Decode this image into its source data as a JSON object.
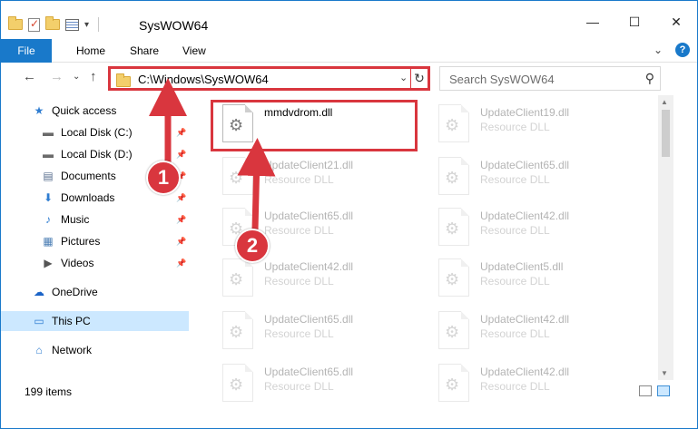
{
  "window": {
    "title": "SysWOW64",
    "controls": {
      "minimize": "—",
      "maximize": "☐",
      "close": "✕"
    }
  },
  "ribbon": {
    "tabs": [
      "File",
      "Home",
      "Share",
      "View"
    ],
    "expand": "⌄",
    "help": "?"
  },
  "nav": {
    "back": "←",
    "forward": "→",
    "recent": "⌄",
    "up": "↑",
    "address": "C:\\Windows\\SysWOW64",
    "address_dropdown": "⌄",
    "refresh": "↻",
    "search_placeholder": "Search SysWOW64",
    "search_icon": "⚲"
  },
  "sidebar": {
    "items": [
      {
        "label": "Quick access",
        "icon": "star-icon",
        "pinned": false
      },
      {
        "label": "Local Disk (C:)",
        "icon": "drive-icon",
        "pinned": true
      },
      {
        "label": "Local Disk (D:)",
        "icon": "drive-icon",
        "pinned": true
      },
      {
        "label": "Documents",
        "icon": "documents-icon",
        "pinned": true
      },
      {
        "label": "Downloads",
        "icon": "download-icon",
        "pinned": true
      },
      {
        "label": "Music",
        "icon": "music-icon",
        "pinned": true
      },
      {
        "label": "Pictures",
        "icon": "pictures-icon",
        "pinned": true
      },
      {
        "label": "Videos",
        "icon": "videos-icon",
        "pinned": true
      },
      {
        "label": "OneDrive",
        "icon": "cloud-icon",
        "pinned": false
      },
      {
        "label": "This PC",
        "icon": "computer-icon",
        "pinned": false,
        "selected": true
      },
      {
        "label": "Network",
        "icon": "network-icon",
        "pinned": false
      }
    ]
  },
  "files": [
    {
      "name": "mmdvdrom.dll",
      "type": "",
      "highlight": true
    },
    {
      "name": "UpdateClient19.dll",
      "type": "Resource DLL"
    },
    {
      "name": "UpdateClient21.dll",
      "type": "Resource DLL"
    },
    {
      "name": "UpdateClient65.dll",
      "type": "Resource DLL"
    },
    {
      "name": "UpdateClient65.dll",
      "type": "Resource DLL"
    },
    {
      "name": "UpdateClient42.dll",
      "type": "Resource DLL"
    },
    {
      "name": "UpdateClient42.dll",
      "type": "Resource DLL"
    },
    {
      "name": "UpdateClient5.dll",
      "type": "Resource DLL"
    },
    {
      "name": "UpdateClient65.dll",
      "type": "Resource DLL"
    },
    {
      "name": "UpdateClient42.dll",
      "type": "Resource DLL"
    },
    {
      "name": "UpdateClient65.dll",
      "type": "Resource DLL"
    },
    {
      "name": "UpdateClient42.dll",
      "type": "Resource DLL"
    }
  ],
  "status": {
    "item_count": "199 items"
  },
  "annotations": {
    "badge1": "1",
    "badge2": "2"
  },
  "colors": {
    "accent": "#1979ca",
    "highlight": "#d9363e",
    "selected": "#cce8ff"
  }
}
